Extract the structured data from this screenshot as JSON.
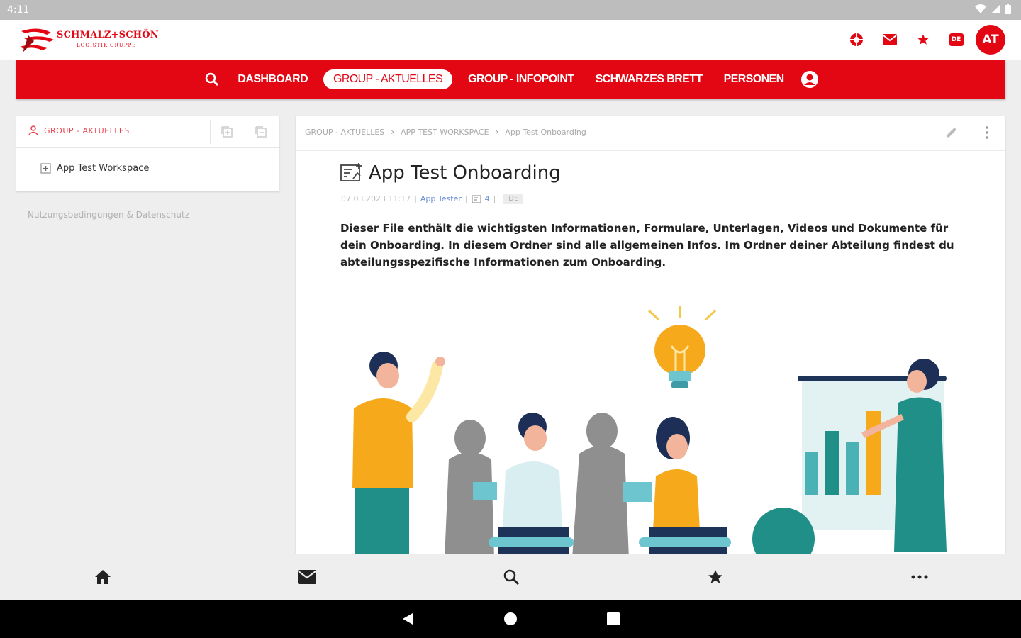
{
  "status_bar": {
    "time": "4:11"
  },
  "header": {
    "logo_brand": "SCHMALZ+SCHÖN",
    "logo_sub": "LOGISTIK-GRUPPE",
    "lang_badge": "DE",
    "avatar_initials": "AT"
  },
  "nav": {
    "items": [
      {
        "label": "DASHBOARD"
      },
      {
        "label": "GROUP - AKTUELLES"
      },
      {
        "label": "GROUP - INFOPOINT"
      },
      {
        "label": "SCHWARZES BRETT"
      },
      {
        "label": "PERSONEN"
      }
    ]
  },
  "sidebar": {
    "title": "GROUP - AKTUELLES",
    "items": [
      {
        "label": "App Test Workspace"
      }
    ],
    "terms_link": "Nutzungsbedingungen & Datenschutz"
  },
  "breadcrumb": {
    "items": [
      "GROUP - AKTUELLES",
      "APP TEST WORKSPACE",
      "App Test Onboarding"
    ]
  },
  "document": {
    "title": "App Test Onboarding",
    "date": "07.03.2023 11:17",
    "author": "App Tester",
    "attachment_count": "4",
    "language": "DE",
    "description": "Dieser File enthält die wichtigsten Informationen, Formulare, Unterlagen, Videos und Dokumente für dein Onboarding. In diesem Ordner sind alle allgemeinen Infos. Im Ordner deiner Abteilung findest du abteilungsspezifische Informationen zum Onboarding."
  },
  "colors": {
    "brand_red": "#e30613",
    "link_blue": "#6b8fd6"
  }
}
